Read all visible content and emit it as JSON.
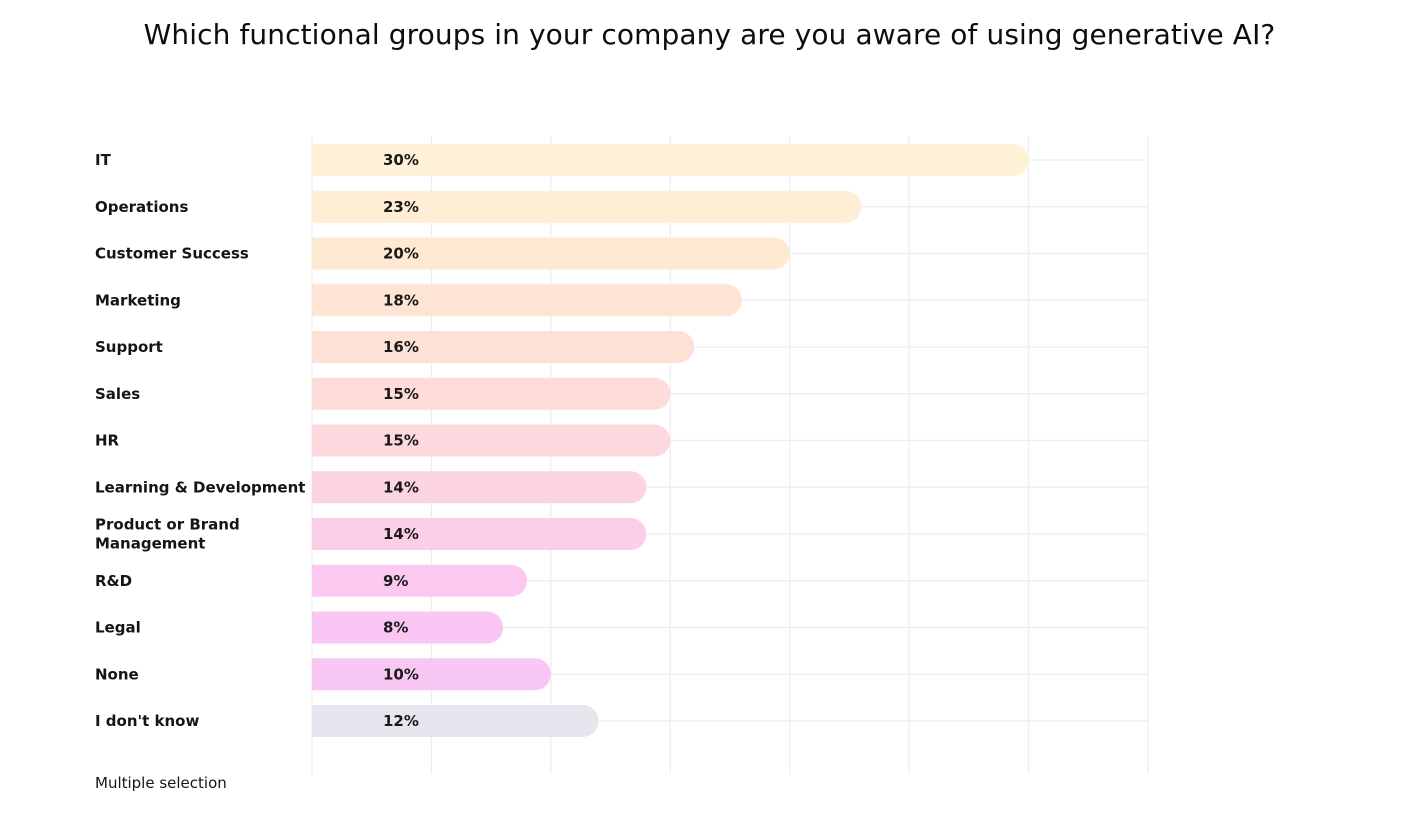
{
  "chart_data": {
    "type": "bar",
    "orientation": "horizontal",
    "title": "Which functional groups in your company are you aware of using generative AI?",
    "xlabel": "",
    "ylabel": "",
    "xlim": [
      0,
      35
    ],
    "grid": true,
    "categories": [
      "IT",
      "Operations",
      "Customer Success",
      "Marketing",
      "Support",
      "Sales",
      "HR",
      "Learning & Development",
      "Product or Brand Management",
      "R&D",
      "Legal",
      "None",
      "I don't know"
    ],
    "category_lines": [
      [
        "IT"
      ],
      [
        "Operations"
      ],
      [
        "Customer Success"
      ],
      [
        "Marketing"
      ],
      [
        "Support"
      ],
      [
        "Sales"
      ],
      [
        "HR"
      ],
      [
        "Learning & Development"
      ],
      [
        "Product or Brand",
        "Management"
      ],
      [
        "R&D"
      ],
      [
        "Legal"
      ],
      [
        "None"
      ],
      [
        "I don't know"
      ]
    ],
    "values": [
      30,
      23,
      20,
      18,
      16,
      15,
      15,
      14,
      14,
      9,
      8,
      10,
      12
    ],
    "value_labels": [
      "30%",
      "23%",
      "20%",
      "18%",
      "16%",
      "15%",
      "15%",
      "14%",
      "14%",
      "9%",
      "8%",
      "10%",
      "12%"
    ],
    "colors": [
      "#fff1d7",
      "#ffedd5",
      "#feead3",
      "#fde4d4",
      "#fde0d6",
      "#fddcd9",
      "#fdd8df",
      "#fdd4e3",
      "#fccfe9",
      "#fbc9f0",
      "#fac6f3",
      "#f9c7f4",
      "#e5e6ee"
    ],
    "footnote": "Multiple selection"
  }
}
